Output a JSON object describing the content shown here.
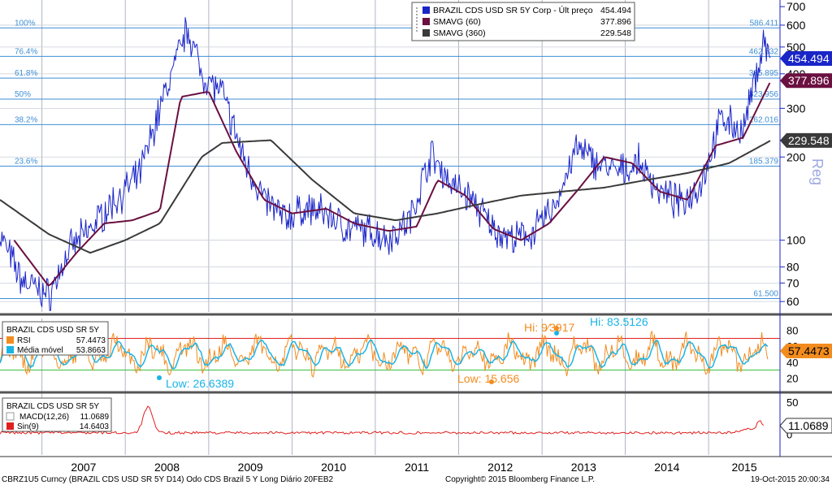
{
  "theme": {
    "bg": "#ffffff",
    "grid": "#9aa3b3",
    "axis_text": "#000000",
    "accent": "#1a25c8",
    "accent2": "#6b1040",
    "accent3": "#3a3a3a",
    "fib": "#3e8fd6",
    "rsi": "#f28c1e",
    "rsi_ma": "#19b4e6",
    "macd_sig": "#e0201e"
  },
  "x_years": [
    "2007",
    "2008",
    "2009",
    "2010",
    "2011",
    "2012",
    "2013",
    "2014",
    "2015"
  ],
  "price_panel": {
    "legend": [
      {
        "name": "BRAZIL CDS USD SR 5Y Corp - Últ preço",
        "value": "454.494",
        "color": "#1a25c8"
      },
      {
        "name": "SMAVG (60)",
        "value": "377.896",
        "color": "#6b1040"
      },
      {
        "name": "SMAVG (360)",
        "value": "229.548",
        "color": "#3a3a3a"
      }
    ],
    "y_ticks": [
      "700",
      "600",
      "500",
      "400",
      "300",
      "200",
      "100",
      "80",
      "70",
      "60"
    ],
    "y_axis_label": "Reg",
    "fib_levels": [
      {
        "pct": "100%",
        "value": "586.411",
        "y": 586.411
      },
      {
        "pct": "76.4%",
        "value": "462.532",
        "y": 462.532
      },
      {
        "pct": "61.8%",
        "value": "385.895",
        "y": 385.895
      },
      {
        "pct": "50%",
        "value": "323.956",
        "y": 323.956
      },
      {
        "pct": "38.2%",
        "value": "262.016",
        "y": 262.016
      },
      {
        "pct": "23.6%",
        "value": "185.379",
        "y": 185.379
      },
      {
        "pct": "",
        "value": "61.500",
        "y": 61.5
      }
    ],
    "tags": [
      {
        "text": "454.494",
        "y": 454.494,
        "bg": "#1a25c8"
      },
      {
        "text": "377.896",
        "y": 377.896,
        "bg": "#6b1040"
      },
      {
        "text": "229.548",
        "y": 229.548,
        "bg": "#3a3a3a"
      }
    ]
  },
  "rsi_panel": {
    "title": "BRAZIL CDS USD SR 5Y",
    "legend": [
      {
        "name": "RSI",
        "value": "57.4473",
        "color": "#f28c1e"
      },
      {
        "name": "Média móvel",
        "value": "53.8663",
        "color": "#19b4e6"
      }
    ],
    "y_ticks": [
      "80",
      "60",
      "40",
      "20"
    ],
    "annotations": [
      {
        "text": "Hi: 9⁄3917",
        "color": "#f28c1e"
      },
      {
        "text": "Hi: 83.5126",
        "color": "#19b4e6"
      },
      {
        "text": "Low: 26.6389",
        "color": "#19b4e6"
      },
      {
        "text": "Low: 15.656",
        "color": "#f28c1e"
      }
    ],
    "tag": "57.4473"
  },
  "macd_panel": {
    "title": "BRAZIL CDS USD SR 5Y",
    "legend": [
      {
        "name": "MACD(12,26)",
        "value": "11.0689",
        "color": "#ffffff"
      },
      {
        "name": "Sin(9)",
        "value": "14.6403",
        "color": "#e0201e"
      }
    ],
    "y_ticks": [
      "50",
      "0"
    ],
    "tag": "11.0689"
  },
  "footer": {
    "left": "CBRZ1U5 Curncy (BRAZIL CDS USD SR 5Y D14) Odo CDS Brazil 5 Y Long  Diário 20FEB2",
    "middle": "Copyright© 2015 Bloomberg Finance L.P.",
    "right": "19-Oct-2015 20:00:34"
  },
  "chart_data": {
    "type": "line",
    "title": "BRAZIL CDS USD SR 5Y",
    "x_range": [
      "2006-07",
      "2015-10"
    ],
    "y_scale": "log",
    "ylim": [
      55,
      720
    ],
    "series": [
      {
        "name": "BRAZIL CDS USD SR 5Y Corp - Últ preço",
        "x": [
          "2006-07",
          "2006-10",
          "2007-02",
          "2007-05",
          "2007-08",
          "2007-11",
          "2008-03",
          "2008-06",
          "2008-10",
          "2008-12",
          "2009-03",
          "2009-06",
          "2009-09",
          "2009-12",
          "2010-03",
          "2010-06",
          "2010-09",
          "2010-12",
          "2011-03",
          "2011-06",
          "2011-09",
          "2011-12",
          "2012-03",
          "2012-06",
          "2012-09",
          "2012-12",
          "2013-03",
          "2013-06",
          "2013-09",
          "2013-12",
          "2014-03",
          "2014-06",
          "2014-09",
          "2014-12",
          "2015-03",
          "2015-06",
          "2015-09",
          "2015-10"
        ],
        "y": [
          105,
          72,
          63,
          92,
          110,
          135,
          170,
          300,
          590,
          400,
          340,
          200,
          140,
          120,
          130,
          125,
          110,
          108,
          102,
          118,
          205,
          160,
          140,
          110,
          100,
          108,
          135,
          215,
          190,
          175,
          190,
          150,
          135,
          162,
          280,
          245,
          530,
          454.494
        ]
      },
      {
        "name": "SMAVG (60)",
        "x": [
          "2006-09",
          "2007-02",
          "2007-06",
          "2007-10",
          "2008-02",
          "2008-06",
          "2008-09",
          "2009-01",
          "2009-05",
          "2009-09",
          "2010-01",
          "2010-06",
          "2010-10",
          "2011-03",
          "2011-07",
          "2011-10",
          "2012-02",
          "2012-06",
          "2012-10",
          "2013-02",
          "2013-06",
          "2013-10",
          "2014-02",
          "2014-06",
          "2014-10",
          "2015-02",
          "2015-06",
          "2015-10"
        ],
        "y": [
          100,
          68,
          90,
          115,
          118,
          128,
          330,
          345,
          210,
          140,
          125,
          130,
          115,
          108,
          112,
          165,
          145,
          110,
          100,
          115,
          150,
          200,
          190,
          150,
          140,
          220,
          235,
          377.896
        ]
      },
      {
        "name": "SMAVG (360)",
        "x": [
          "2006-07",
          "2007-02",
          "2007-08",
          "2008-01",
          "2008-06",
          "2008-12",
          "2009-03",
          "2009-10",
          "2010-04",
          "2010-10",
          "2011-04",
          "2011-10",
          "2012-04",
          "2012-10",
          "2013-04",
          "2013-10",
          "2014-04",
          "2014-10",
          "2015-04",
          "2015-10"
        ],
        "y": [
          140,
          105,
          90,
          100,
          115,
          200,
          225,
          230,
          165,
          125,
          118,
          125,
          135,
          145,
          150,
          155,
          165,
          175,
          190,
          229.548
        ]
      }
    ]
  }
}
